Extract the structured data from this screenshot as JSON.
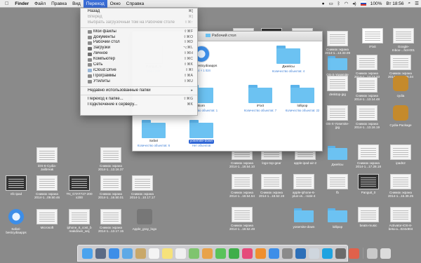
{
  "menubar": {
    "apple": "",
    "items": [
      "Finder",
      "Файл",
      "Правка",
      "Вид",
      "Переход",
      "Окно",
      "Справка"
    ],
    "active_index": 4,
    "right": {
      "wifi": "",
      "lang": "",
      "battery": "100%",
      "time": "Вт 18:56"
    }
  },
  "go_menu": {
    "items": [
      {
        "label": "Назад",
        "shortcut": "⌘[",
        "enabled": true
      },
      {
        "label": "Вперед",
        "shortcut": "⌘]",
        "enabled": false
      },
      {
        "label": "Выбрать загрузочный том на Рабочем столе",
        "shortcut": "⇧⌘↑",
        "enabled": false
      },
      {
        "label": "Мои файлы",
        "shortcut": "⇧⌘F",
        "enabled": true,
        "icon_color": "#8c8c8c"
      },
      {
        "label": "Документы",
        "shortcut": "⇧⌘O",
        "enabled": true,
        "icon_color": "#8c8c8c"
      },
      {
        "label": "Рабочий стол",
        "shortcut": "⇧⌘D",
        "enabled": true,
        "icon_color": "#8c8c8c"
      },
      {
        "label": "Загрузки",
        "shortcut": "⌥⌘L",
        "enabled": true,
        "icon_color": "#6f6f6f"
      },
      {
        "label": "Личное",
        "shortcut": "⇧⌘H",
        "enabled": true,
        "icon_color": "#6f6f6f"
      },
      {
        "label": "Компьютер",
        "shortcut": "⇧⌘C",
        "enabled": true,
        "icon_color": "#8c8c8c"
      },
      {
        "label": "Сеть",
        "shortcut": "⇧⌘K",
        "enabled": true,
        "icon_color": "#8c8c8c"
      },
      {
        "label": "iCloud Drive",
        "shortcut": "⇧⌘I",
        "enabled": true,
        "icon_color": "#9ab8d8"
      },
      {
        "label": "Программы",
        "shortcut": "⇧⌘A",
        "enabled": true,
        "icon_color": "#8c8c8c"
      },
      {
        "label": "Утилиты",
        "shortcut": "⇧⌘U",
        "enabled": true,
        "icon_color": "#8c8c8c"
      },
      {
        "label": "Недавно использованные папки",
        "shortcut": "▸",
        "enabled": true
      },
      {
        "label": "Переход к папке...",
        "shortcut": "⇧⌘G",
        "enabled": true
      },
      {
        "label": "Подключение к серверу...",
        "shortcut": "⌘K",
        "enabled": true
      }
    ]
  },
  "finder_window": {
    "title": "Рабочий стол",
    "items": [
      {
        "name": "Panguit_0",
        "sub": "200 x 200",
        "kind": "image"
      },
      {
        "name": "Safari-bestcydiaapps",
        "sub": "1 024 × 1 024",
        "kind": "safari"
      },
      {
        "name": "Джейсы",
        "sub": "Количество объектов: 4",
        "kind": "folder"
      },
      {
        "name": "Born",
        "sub": "Количество объектов: 1",
        "kind": "folder"
      },
      {
        "name": "iFixit",
        "sub": "Количество объектов: 7",
        "kind": "folder"
      },
      {
        "name": "lollipop",
        "sub": "Количество объектов: 22",
        "kind": "folder"
      },
      {
        "name": "Safari",
        "sub": "Количество объектов: 6",
        "kind": "folder"
      },
      {
        "name": "yosemite-down",
        "sub": "Нет объектов",
        "kind": "folder",
        "selected": true
      }
    ]
  },
  "desktop_icons": [
    {
      "l1": "ipad-air2",
      "l2": "",
      "kind": "doc"
    },
    {
      "l1": "microsoft",
      "l2": "",
      "kind": "dark"
    },
    {
      "l1": "OT",
      "l2": "",
      "kind": "doc"
    },
    {
      "l1": "Снимок экрана",
      "l2": "2014-1...13.33.09",
      "kind": "doc"
    },
    {
      "l1": "iFixit",
      "l2": "",
      "kind": "white"
    },
    {
      "l1": "Google-",
      "l2": "Inbox-...hot-001",
      "kind": "doc"
    },
    {
      "l1": "OS-X-Yosemite",
      "l2": "",
      "kind": "folder"
    },
    {
      "l1": "Снимок экрана",
      "l2": "2014-1...14.13.33",
      "kind": "doc"
    },
    {
      "l1": "Снимок экрана",
      "l2": "2014-1...22.26.04",
      "kind": "doc"
    },
    {
      "l1": "desktop-jpg",
      "l2": "",
      "kind": "doc"
    },
    {
      "l1": "Снимок экрана",
      "l2": "2014-1...13.14.48",
      "kind": "doc"
    },
    {
      "l1": "cydia",
      "l2": "",
      "kind": "cydia"
    },
    {
      "l1": "OS-X-Yosemite-",
      "l2": "jpg",
      "kind": "doc"
    },
    {
      "l1": "Снимок экрана",
      "l2": "2014-1...13.16.19",
      "kind": "doc"
    },
    {
      "l1": "Cydia-Package",
      "l2": "",
      "kind": "cydia"
    },
    {
      "l1": "iOS-6-Cydia-",
      "l2": "Jailbreak",
      "kind": "doc"
    },
    {
      "l1": "Снимок экрана",
      "l2": "2014-1...13.16.37",
      "kind": "doc"
    },
    {
      "l1": "Снимок экрана",
      "l2": "2014-1...18.54.10",
      "kind": "doc"
    },
    {
      "l1": "logo-top-gear",
      "l2": "",
      "kind": "doc"
    },
    {
      "l1": "apple-ipad-air-2",
      "l2": "",
      "kind": "doc"
    },
    {
      "l1": "Джейсы",
      "l2": "",
      "kind": "folder"
    },
    {
      "l1": "Снимок экрана",
      "l2": "2014-1...17.28.18",
      "kind": "doc"
    },
    {
      "l1": "ipads2",
      "l2": "",
      "kind": "doc"
    },
    {
      "l1": "nfc-ipad",
      "l2": "",
      "kind": "dark"
    },
    {
      "l1": "Снимок экрана",
      "l2": "2014-1...09.50.46",
      "kind": "doc"
    },
    {
      "l1": "TN_GTAT727-200",
      "l2": "x200",
      "kind": "dark"
    },
    {
      "l1": "Снимок экрана",
      "l2": "2014-1...16.50.01",
      "kind": "doc"
    },
    {
      "l1": "Снимок экрана",
      "l2": "2014-1...18.54.54",
      "kind": "doc"
    },
    {
      "l1": "Снимок экрана",
      "l2": "2014-1...18.52.19",
      "kind": "doc"
    },
    {
      "l1": "apple-iphone-6-",
      "l2": "plus-vs...-note-4",
      "kind": "doc"
    },
    {
      "l1": "fb",
      "l2": "",
      "kind": "doc"
    },
    {
      "l1": "Panguit_0",
      "l2": "",
      "kind": "dark"
    },
    {
      "l1": "Снимок экрана",
      "l2": "2014-1...15.39.25",
      "kind": "doc"
    },
    {
      "l1": "Safari-",
      "l2": "bestcydiaapps",
      "kind": "safari"
    },
    {
      "l1": "Microsoft",
      "l2": "",
      "kind": "doc"
    },
    {
      "l1": "iphone_6_cost_b",
      "l2": "reakdown_wsj",
      "kind": "doc"
    },
    {
      "l1": "Снимок экрана",
      "l2": "2014-1...13.17.15",
      "kind": "doc"
    },
    {
      "l1": "Apple_gray_logo",
      "l2": "",
      "kind": "apple"
    },
    {
      "l1": "Снимок экрана",
      "l2": "2014-1...18.52.49",
      "kind": "doc"
    },
    {
      "l1": "yosemite-down",
      "l2": "",
      "kind": "folder"
    },
    {
      "l1": "lollipop",
      "l2": "",
      "kind": "folder"
    },
    {
      "l1": "beats-music",
      "l2": "",
      "kind": "doc"
    },
    {
      "l1": "Activator-iOS-8-",
      "l2": "beta-a...024x904",
      "kind": "doc"
    },
    {
      "l1": "Снимок экрана",
      "l2": "2014-1...10.17.17",
      "kind": "doc"
    }
  ],
  "dock": {
    "apps": [
      {
        "name": "finder-icon",
        "color": "#4aa3ee"
      },
      {
        "name": "launchpad-icon",
        "color": "#5a6a85"
      },
      {
        "name": "safari-icon",
        "color": "#3d8ee8"
      },
      {
        "name": "mail-icon",
        "color": "#5ea9e6"
      },
      {
        "name": "contacts-icon",
        "color": "#c9a86a"
      },
      {
        "name": "calendar-icon",
        "color": "#f4f4f4"
      },
      {
        "name": "notes-icon",
        "color": "#f6e27a"
      },
      {
        "name": "reminders-icon",
        "color": "#f0f0f0"
      },
      {
        "name": "maps-icon",
        "color": "#7fc46e"
      },
      {
        "name": "photos-icon",
        "color": "#e8a24a"
      },
      {
        "name": "messages-icon",
        "color": "#59c25a"
      },
      {
        "name": "facetime-icon",
        "color": "#3fae4a"
      },
      {
        "name": "itunes-icon",
        "color": "#e54b7b"
      },
      {
        "name": "ibooks-icon",
        "color": "#ef8f2f"
      },
      {
        "name": "app-store-icon",
        "color": "#3d8ee8"
      },
      {
        "name": "system-preferences-icon",
        "color": "#8a8a8a"
      },
      {
        "name": "app-icon-1",
        "color": "#2d6fb8"
      },
      {
        "name": "app-icon-2",
        "color": "#cfd6de"
      },
      {
        "name": "skype-icon",
        "color": "#1ea3e0"
      },
      {
        "name": "app-icon-3",
        "color": "#6b6b6b"
      },
      {
        "name": "app-icon-4",
        "color": "#e0614b"
      }
    ],
    "right": [
      {
        "name": "downloads-stack-icon",
        "color": "#c9c9c9"
      },
      {
        "name": "trash-icon",
        "color": "#dcdcdc"
      }
    ]
  }
}
